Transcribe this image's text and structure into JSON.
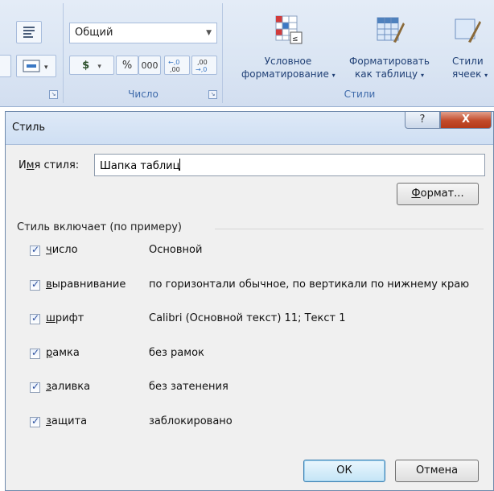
{
  "ribbon": {
    "number_group": {
      "format_value": "Общий",
      "currency_symbol": "$",
      "percent_symbol": "%",
      "thousands_symbol": "000",
      "increase_decimal": "←,0 ,00",
      "decrease_decimal": ",00 →,0",
      "label": "Число"
    },
    "styles_group": {
      "conditional_line1": "Условное",
      "conditional_line2": "форматирование",
      "table_line1": "Форматировать",
      "table_line2": "как таблицу",
      "cell_styles_line1": "Стили",
      "cell_styles_line2": "ячеек",
      "label": "Стили"
    }
  },
  "dialog": {
    "title": "Стиль",
    "help_glyph": "?",
    "close_glyph": "X",
    "style_name_label_prefix": "И",
    "style_name_label_underlined": "м",
    "style_name_label_suffix": "я стиля:",
    "style_name_value": "Шапка таблиц",
    "format_button_underlined": "Ф",
    "format_button_rest": "ормат...",
    "includes_label": "Стиль включает (по примеру)",
    "options": [
      {
        "key_letter": "ч",
        "rest": "исло",
        "value": "Основной",
        "checked": true
      },
      {
        "key_letter": "в",
        "rest": "ыравнивание",
        "value": "по горизонтали обычное, по вертикали по нижнему краю",
        "checked": true
      },
      {
        "key_letter": "ш",
        "rest": "рифт",
        "value": "Calibri (Основной текст) 11; Текст 1",
        "checked": true
      },
      {
        "key_letter": "р",
        "rest": "амка",
        "value": "без рамок",
        "checked": true
      },
      {
        "key_letter": "з",
        "rest": "аливка",
        "value": "без затенения",
        "checked": true
      },
      {
        "key_letter": "з",
        "rest": "ащита",
        "value": "заблокировано",
        "checked": true
      }
    ],
    "ok_label": "ОК",
    "cancel_label": "Отмена"
  },
  "colors": {
    "ribbon_bg": "#dae5f3",
    "ribbon_label": "#3e6aaa",
    "dialog_bg": "#f0f0f0",
    "close_button": "#c24a2a"
  }
}
